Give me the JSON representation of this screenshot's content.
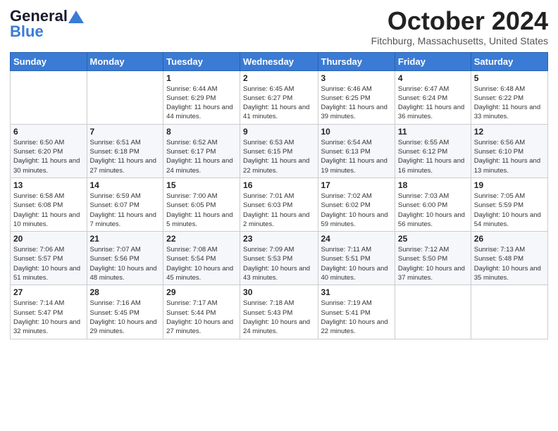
{
  "header": {
    "logo_general": "General",
    "logo_blue": "Blue",
    "month_title": "October 2024",
    "location": "Fitchburg, Massachusetts, United States"
  },
  "days_of_week": [
    "Sunday",
    "Monday",
    "Tuesday",
    "Wednesday",
    "Thursday",
    "Friday",
    "Saturday"
  ],
  "weeks": [
    [
      {
        "day": "",
        "info": ""
      },
      {
        "day": "",
        "info": ""
      },
      {
        "day": "1",
        "info": "Sunrise: 6:44 AM\nSunset: 6:29 PM\nDaylight: 11 hours and 44 minutes."
      },
      {
        "day": "2",
        "info": "Sunrise: 6:45 AM\nSunset: 6:27 PM\nDaylight: 11 hours and 41 minutes."
      },
      {
        "day": "3",
        "info": "Sunrise: 6:46 AM\nSunset: 6:25 PM\nDaylight: 11 hours and 39 minutes."
      },
      {
        "day": "4",
        "info": "Sunrise: 6:47 AM\nSunset: 6:24 PM\nDaylight: 11 hours and 36 minutes."
      },
      {
        "day": "5",
        "info": "Sunrise: 6:48 AM\nSunset: 6:22 PM\nDaylight: 11 hours and 33 minutes."
      }
    ],
    [
      {
        "day": "6",
        "info": "Sunrise: 6:50 AM\nSunset: 6:20 PM\nDaylight: 11 hours and 30 minutes."
      },
      {
        "day": "7",
        "info": "Sunrise: 6:51 AM\nSunset: 6:18 PM\nDaylight: 11 hours and 27 minutes."
      },
      {
        "day": "8",
        "info": "Sunrise: 6:52 AM\nSunset: 6:17 PM\nDaylight: 11 hours and 24 minutes."
      },
      {
        "day": "9",
        "info": "Sunrise: 6:53 AM\nSunset: 6:15 PM\nDaylight: 11 hours and 22 minutes."
      },
      {
        "day": "10",
        "info": "Sunrise: 6:54 AM\nSunset: 6:13 PM\nDaylight: 11 hours and 19 minutes."
      },
      {
        "day": "11",
        "info": "Sunrise: 6:55 AM\nSunset: 6:12 PM\nDaylight: 11 hours and 16 minutes."
      },
      {
        "day": "12",
        "info": "Sunrise: 6:56 AM\nSunset: 6:10 PM\nDaylight: 11 hours and 13 minutes."
      }
    ],
    [
      {
        "day": "13",
        "info": "Sunrise: 6:58 AM\nSunset: 6:08 PM\nDaylight: 11 hours and 10 minutes."
      },
      {
        "day": "14",
        "info": "Sunrise: 6:59 AM\nSunset: 6:07 PM\nDaylight: 11 hours and 7 minutes."
      },
      {
        "day": "15",
        "info": "Sunrise: 7:00 AM\nSunset: 6:05 PM\nDaylight: 11 hours and 5 minutes."
      },
      {
        "day": "16",
        "info": "Sunrise: 7:01 AM\nSunset: 6:03 PM\nDaylight: 11 hours and 2 minutes."
      },
      {
        "day": "17",
        "info": "Sunrise: 7:02 AM\nSunset: 6:02 PM\nDaylight: 10 hours and 59 minutes."
      },
      {
        "day": "18",
        "info": "Sunrise: 7:03 AM\nSunset: 6:00 PM\nDaylight: 10 hours and 56 minutes."
      },
      {
        "day": "19",
        "info": "Sunrise: 7:05 AM\nSunset: 5:59 PM\nDaylight: 10 hours and 54 minutes."
      }
    ],
    [
      {
        "day": "20",
        "info": "Sunrise: 7:06 AM\nSunset: 5:57 PM\nDaylight: 10 hours and 51 minutes."
      },
      {
        "day": "21",
        "info": "Sunrise: 7:07 AM\nSunset: 5:56 PM\nDaylight: 10 hours and 48 minutes."
      },
      {
        "day": "22",
        "info": "Sunrise: 7:08 AM\nSunset: 5:54 PM\nDaylight: 10 hours and 45 minutes."
      },
      {
        "day": "23",
        "info": "Sunrise: 7:09 AM\nSunset: 5:53 PM\nDaylight: 10 hours and 43 minutes."
      },
      {
        "day": "24",
        "info": "Sunrise: 7:11 AM\nSunset: 5:51 PM\nDaylight: 10 hours and 40 minutes."
      },
      {
        "day": "25",
        "info": "Sunrise: 7:12 AM\nSunset: 5:50 PM\nDaylight: 10 hours and 37 minutes."
      },
      {
        "day": "26",
        "info": "Sunrise: 7:13 AM\nSunset: 5:48 PM\nDaylight: 10 hours and 35 minutes."
      }
    ],
    [
      {
        "day": "27",
        "info": "Sunrise: 7:14 AM\nSunset: 5:47 PM\nDaylight: 10 hours and 32 minutes."
      },
      {
        "day": "28",
        "info": "Sunrise: 7:16 AM\nSunset: 5:45 PM\nDaylight: 10 hours and 29 minutes."
      },
      {
        "day": "29",
        "info": "Sunrise: 7:17 AM\nSunset: 5:44 PM\nDaylight: 10 hours and 27 minutes."
      },
      {
        "day": "30",
        "info": "Sunrise: 7:18 AM\nSunset: 5:43 PM\nDaylight: 10 hours and 24 minutes."
      },
      {
        "day": "31",
        "info": "Sunrise: 7:19 AM\nSunset: 5:41 PM\nDaylight: 10 hours and 22 minutes."
      },
      {
        "day": "",
        "info": ""
      },
      {
        "day": "",
        "info": ""
      }
    ]
  ]
}
